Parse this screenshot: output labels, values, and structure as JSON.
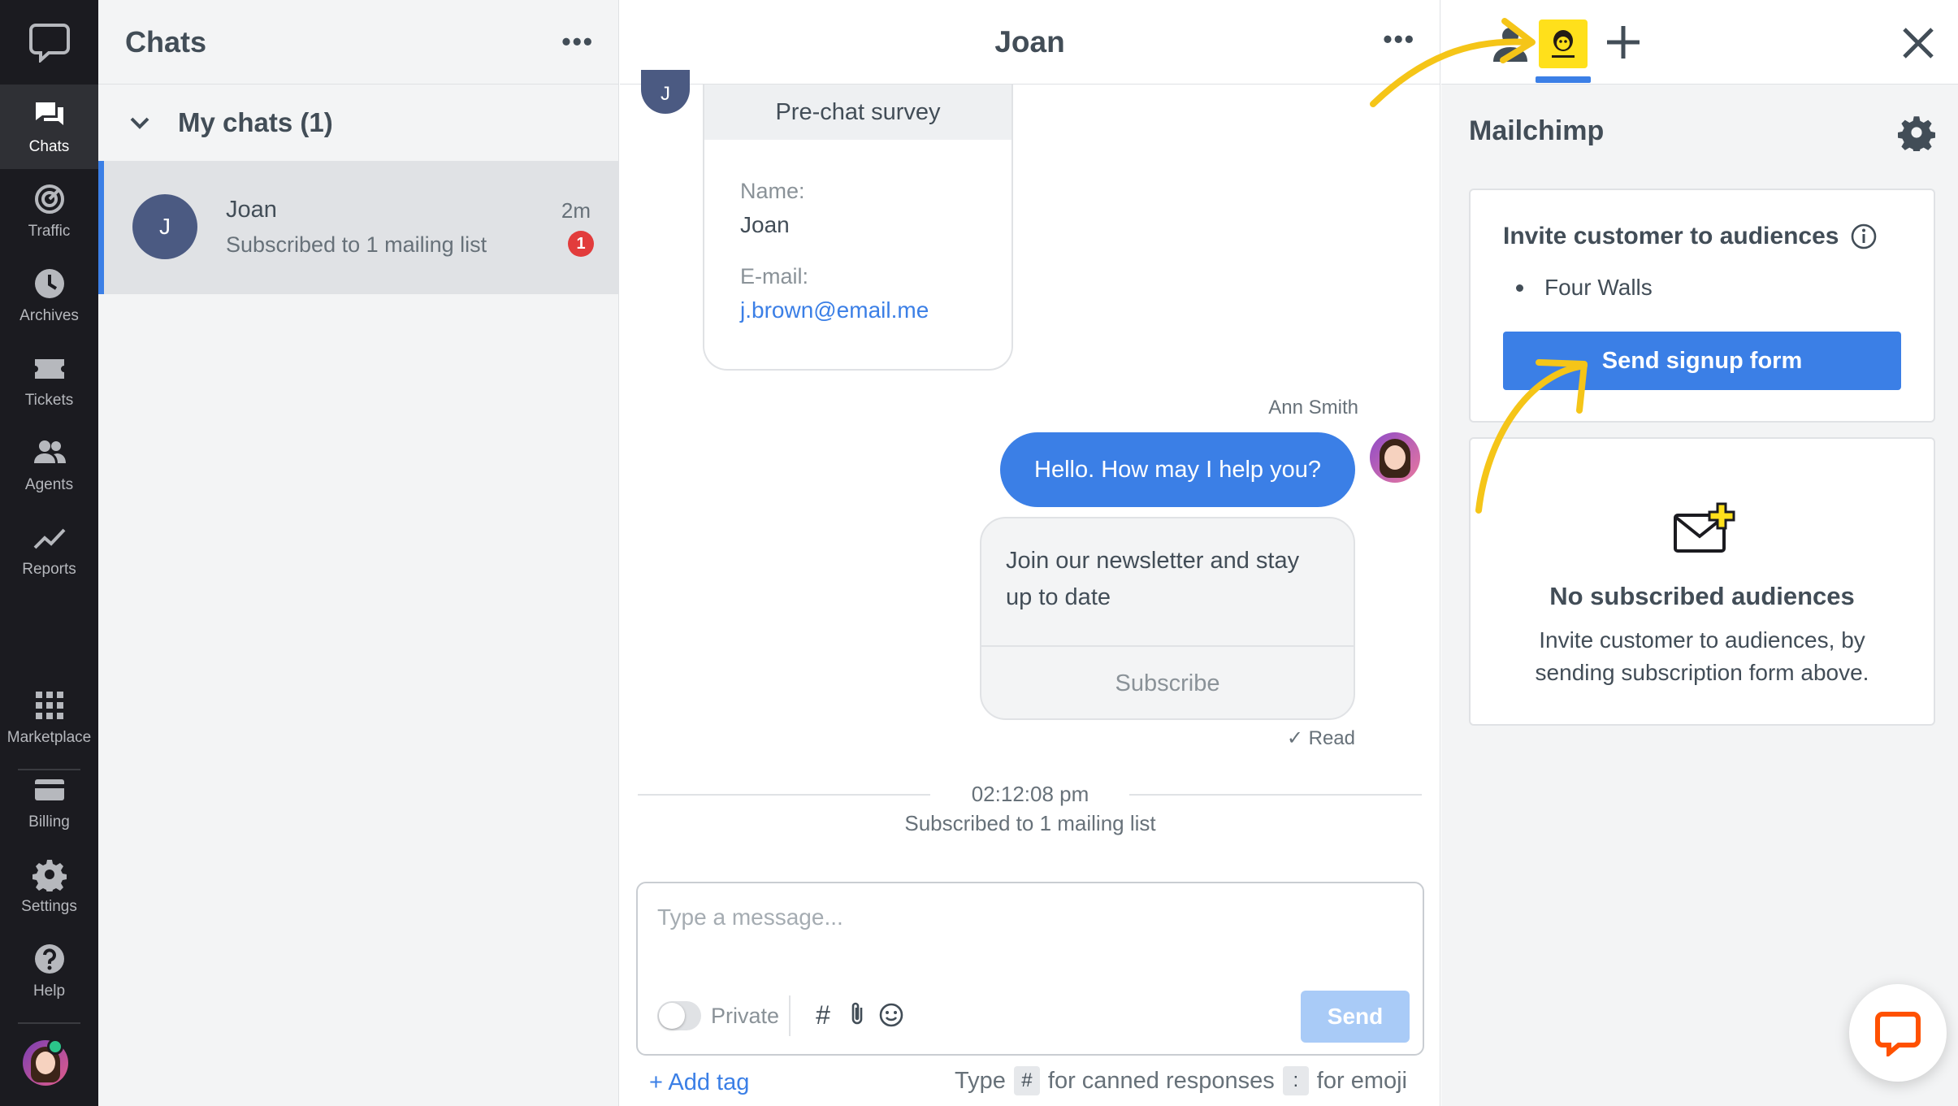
{
  "nav": {
    "items": [
      {
        "label": "Chats",
        "icon": "chats-icon"
      },
      {
        "label": "Traffic",
        "icon": "traffic-icon"
      },
      {
        "label": "Archives",
        "icon": "archives-icon"
      },
      {
        "label": "Tickets",
        "icon": "tickets-icon"
      },
      {
        "label": "Agents",
        "icon": "agents-icon"
      },
      {
        "label": "Reports",
        "icon": "reports-icon"
      },
      {
        "label": "Marketplace",
        "icon": "marketplace-icon"
      },
      {
        "label": "Billing",
        "icon": "billing-icon"
      },
      {
        "label": "Settings",
        "icon": "settings-icon"
      },
      {
        "label": "Help",
        "icon": "help-icon"
      }
    ]
  },
  "chats": {
    "title": "Chats",
    "group_label": "My chats (1)",
    "item": {
      "initial": "J",
      "name": "Joan",
      "preview": "Subscribed to 1 mailing list",
      "time": "2m",
      "badge": "1"
    }
  },
  "conversation": {
    "title": "Joan",
    "customer_initial": "J",
    "survey": {
      "title": "Pre-chat survey",
      "name_label": "Name:",
      "name_value": "Joan",
      "email_label": "E-mail:",
      "email_value": "j.brown@email.me"
    },
    "agent_name": "Ann Smith",
    "agent_message": "Hello. How may I help you?",
    "card_text": "Join our newsletter and stay up to date",
    "card_button": "Subscribe",
    "read_status": "Read",
    "system_time": "02:12:08 pm",
    "system_text": "Subscribed to 1 mailing list",
    "composer": {
      "placeholder": "Type a message...",
      "private_label": "Private",
      "send_label": "Send"
    },
    "add_tag": "+ Add tag",
    "hint": {
      "type": "Type",
      "hash_key": "#",
      "canned": "for canned responses",
      "colon_key": ":",
      "emoji": "for emoji"
    }
  },
  "details": {
    "app_title": "Mailchimp",
    "invite_title": "Invite customer to audiences",
    "audiences": [
      "Four Walls"
    ],
    "signup_button": "Send signup form",
    "empty_title": "No subscribed audiences",
    "empty_text": "Invite customer to audiences, by sending subscription form above."
  },
  "colors": {
    "accent": "#3b7fe6",
    "mailchimp_yellow": "#ffe01b",
    "annotation_arrow": "#f5c518",
    "badge_red": "#e23c3c",
    "brand_orange": "#ff5100"
  }
}
